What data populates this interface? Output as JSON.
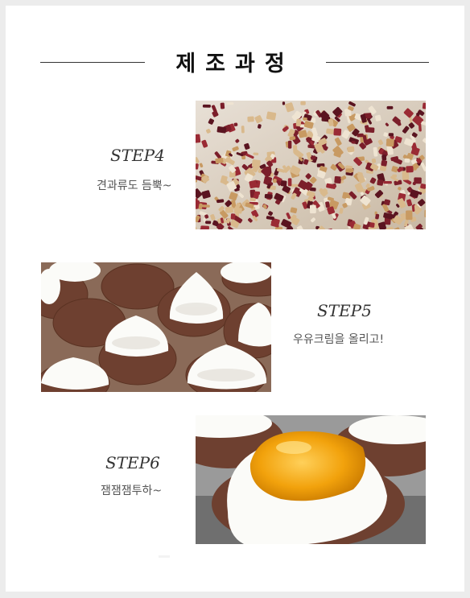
{
  "section": {
    "title": "제조과정"
  },
  "steps": [
    {
      "label": "STEP4",
      "description": "견과류도 듬뿍~",
      "photo_icon": "nuts-photo-icon"
    },
    {
      "label": "STEP5",
      "description": "우유크림을 올리고!",
      "photo_icon": "cream-cookies-photo-icon"
    },
    {
      "label": "STEP6",
      "description": "잼잼잼투하~",
      "photo_icon": "jam-cookie-photo-icon"
    }
  ],
  "colors": {
    "background": "#ececec",
    "page": "#ffffff",
    "title": "#111111",
    "line": "#333333",
    "cookie": "#7a4a32",
    "cream": "#fbfbf8",
    "jam": "#f2a20c",
    "cranberry": "#7b1e2a",
    "walnut": "#d9b98c"
  }
}
